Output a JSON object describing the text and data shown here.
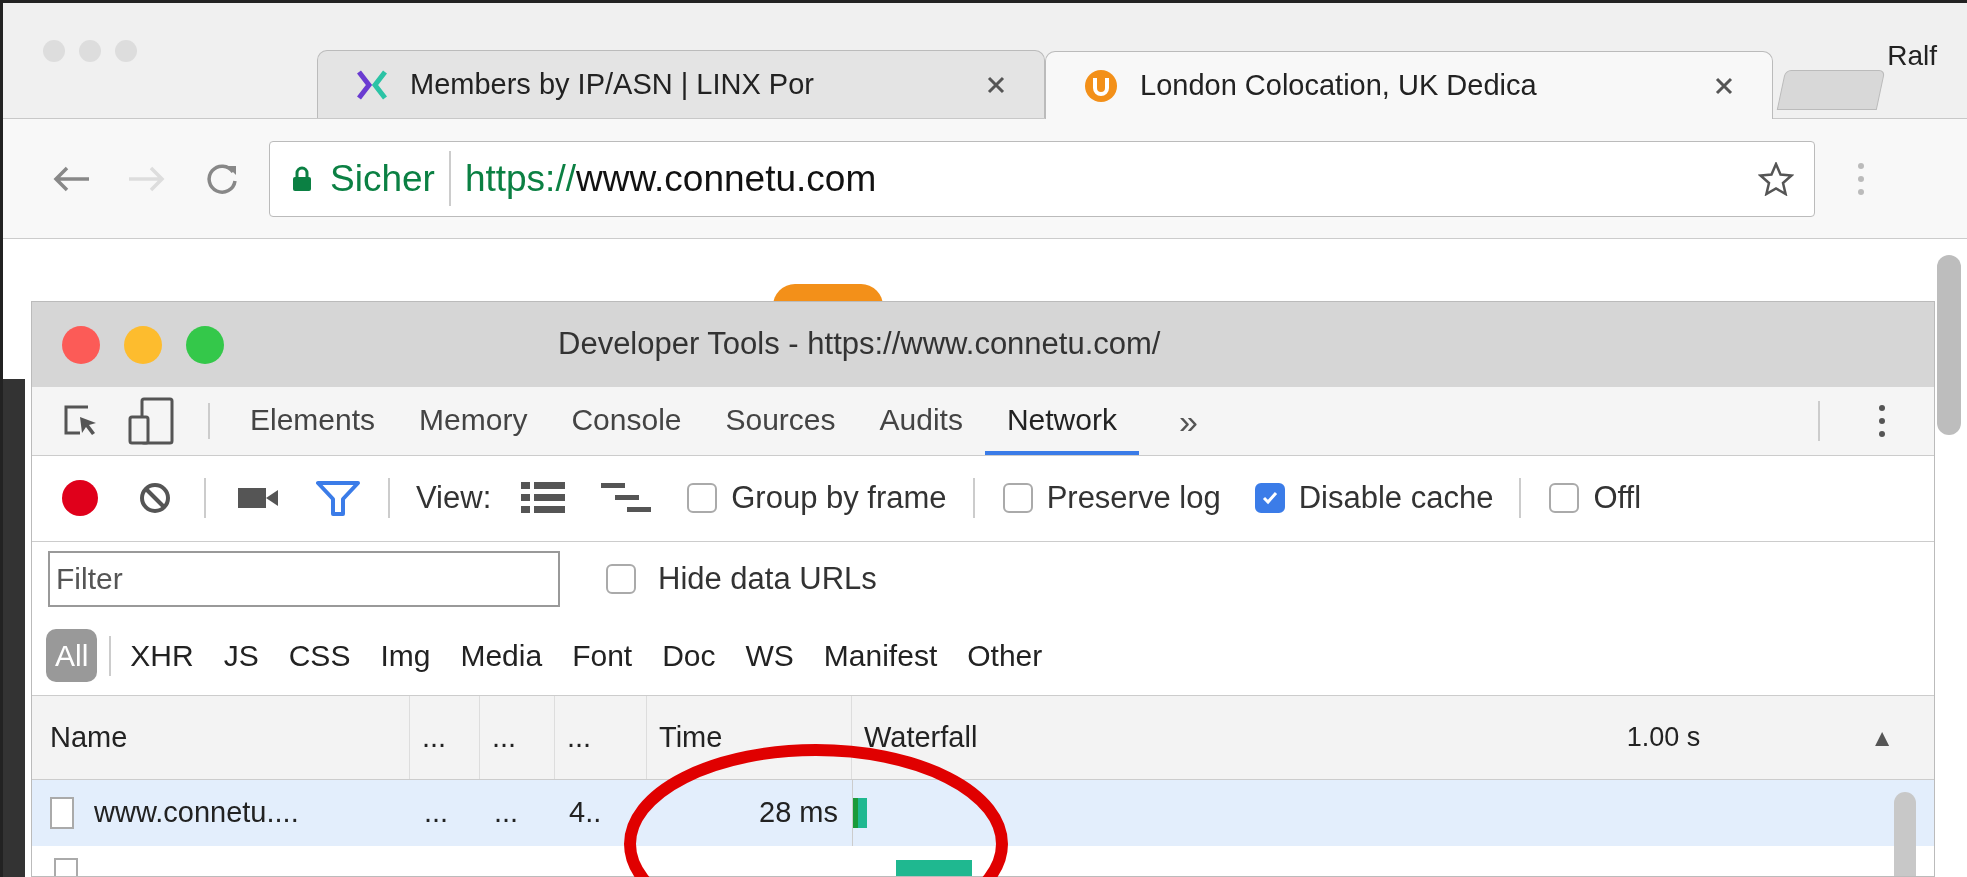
{
  "browser": {
    "tabs": [
      {
        "title": "Members by IP/ASN | LINX Por",
        "kind": "linx",
        "selected": false
      },
      {
        "title": "London Colocation, UK Dedica",
        "kind": "connetu",
        "selected": true
      }
    ],
    "profile": "Ralf",
    "address": {
      "security": "Sicher",
      "scheme": "https://",
      "host": "www.connetu.com"
    }
  },
  "devtools": {
    "title": "Developer Tools - https://www.connetu.com/",
    "panels": [
      {
        "label": "Elements",
        "selected": false
      },
      {
        "label": "Memory",
        "selected": false
      },
      {
        "label": "Console",
        "selected": false
      },
      {
        "label": "Sources",
        "selected": false
      },
      {
        "label": "Audits",
        "selected": false
      },
      {
        "label": "Network",
        "selected": true
      }
    ],
    "overflow": "»",
    "toolbar": {
      "recording": true,
      "view_label": "View:",
      "options": [
        {
          "label": "Group by frame",
          "checked": false
        },
        {
          "label": "Preserve log",
          "checked": false
        },
        {
          "label": "Disable cache",
          "checked": true
        },
        {
          "label": "Offl",
          "checked": false
        }
      ]
    },
    "filter": {
      "placeholder": "Filter",
      "hide_data_urls": {
        "label": "Hide data URLs",
        "checked": false
      }
    },
    "types": [
      {
        "label": "All",
        "selected": true
      },
      {
        "label": "XHR",
        "selected": false
      },
      {
        "label": "JS",
        "selected": false
      },
      {
        "label": "CSS",
        "selected": false
      },
      {
        "label": "Img",
        "selected": false
      },
      {
        "label": "Media",
        "selected": false
      },
      {
        "label": "Font",
        "selected": false
      },
      {
        "label": "Doc",
        "selected": false
      },
      {
        "label": "WS",
        "selected": false
      },
      {
        "label": "Manifest",
        "selected": false
      },
      {
        "label": "Other",
        "selected": false
      }
    ],
    "table": {
      "columns": [
        "Name",
        "...",
        "...",
        "...",
        "Time",
        "Waterfall"
      ],
      "timeline_label": "1.00 s",
      "sort_indicator": "▲",
      "rows": [
        {
          "cells": [
            "www.connetu....",
            "...",
            "...",
            "4..",
            "28 ms"
          ],
          "selected": true
        }
      ]
    }
  }
}
